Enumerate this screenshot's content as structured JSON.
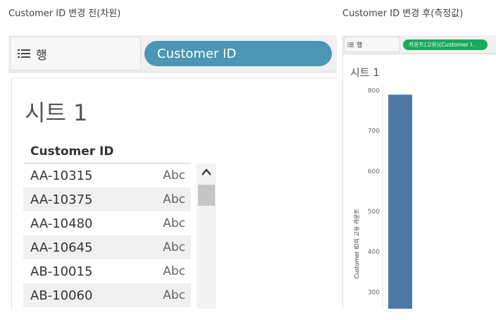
{
  "captions": {
    "before": "Customer ID 변경 전(차원)",
    "after": "Customer ID  변경 후(측정값)"
  },
  "before": {
    "shelf_label": "행",
    "shelf_pill": "Customer ID",
    "sheet_title": "시트 1",
    "column_header": "Customer ID",
    "rows": [
      {
        "id": "AA-10315",
        "type": "Abc"
      },
      {
        "id": "AA-10375",
        "type": "Abc"
      },
      {
        "id": "AA-10480",
        "type": "Abc"
      },
      {
        "id": "AA-10645",
        "type": "Abc"
      },
      {
        "id": "AB-10015",
        "type": "Abc"
      },
      {
        "id": "AB-10060",
        "type": "Abc"
      }
    ],
    "icons": [
      "list-icon",
      "chevron-up-icon"
    ]
  },
  "after": {
    "shelf_label": "행",
    "shelf_pill": "카운트(고유)(Customer I..",
    "sheet_title": "시트 1",
    "pill_color": "#18a85c",
    "bar_color": "#4e79a7"
  },
  "chart_data": {
    "type": "bar",
    "categories": [
      ""
    ],
    "values": [
      790
    ],
    "title": "",
    "xlabel": "",
    "ylabel": "Customer ID의 고유 카운트",
    "yticks": [
      800,
      700,
      600,
      500,
      400,
      300
    ],
    "ylim": [
      255,
      815
    ]
  }
}
